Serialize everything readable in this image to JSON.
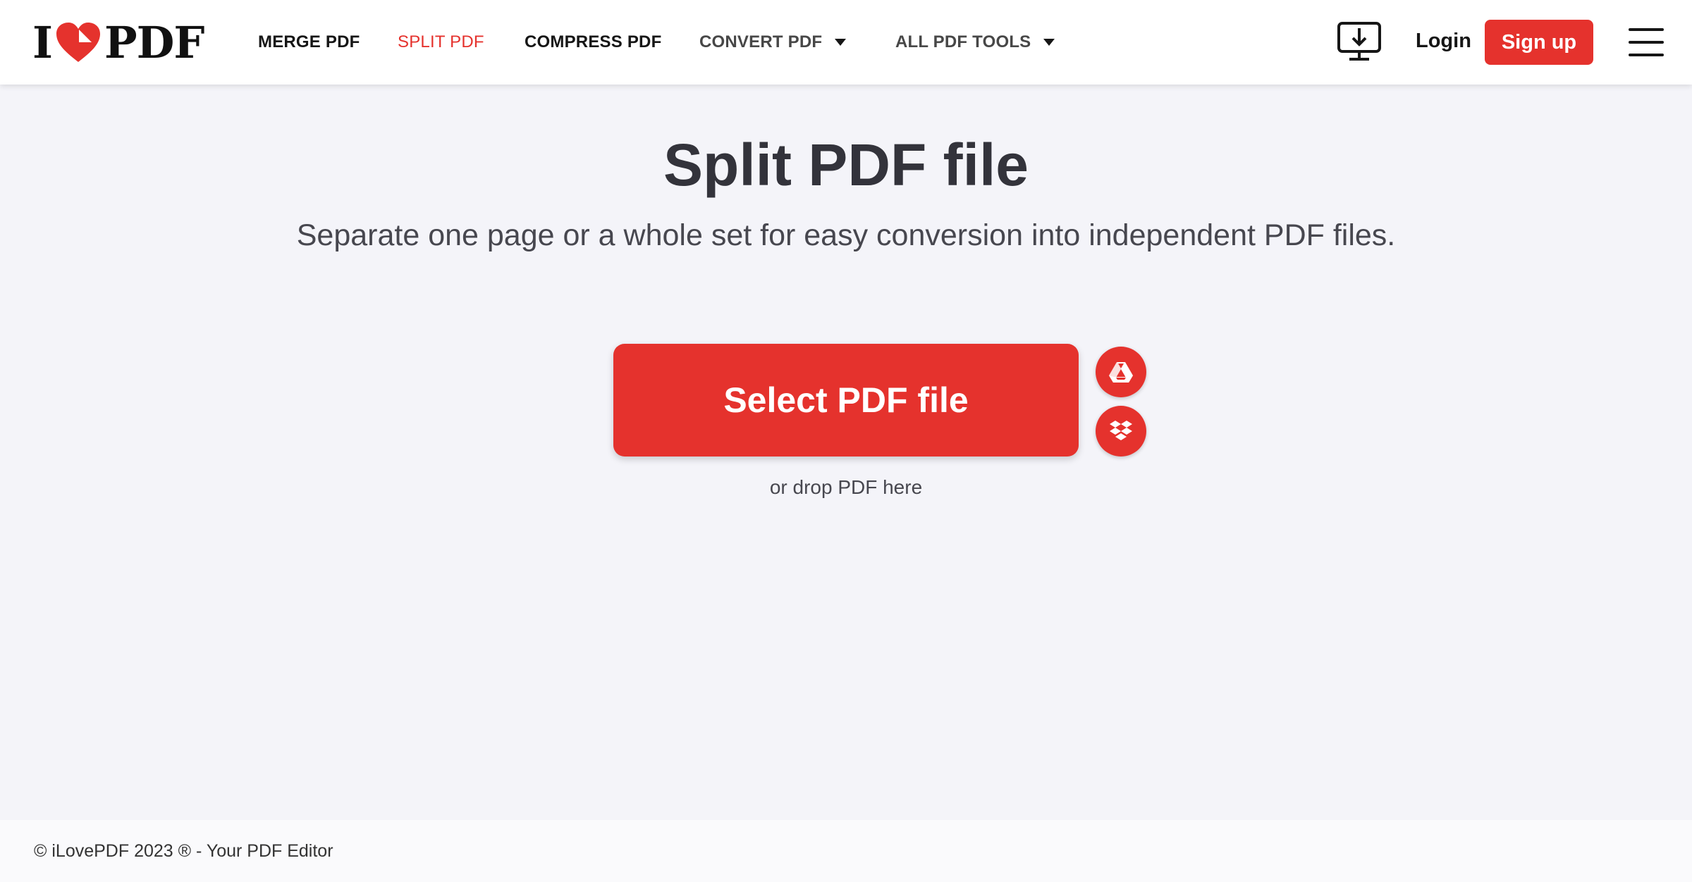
{
  "brand": {
    "logo_left": "I",
    "logo_right": "PDF",
    "accent_color": "#e5322d"
  },
  "nav": {
    "items": [
      {
        "label": "MERGE PDF"
      },
      {
        "label": "SPLIT PDF"
      },
      {
        "label": "COMPRESS PDF"
      },
      {
        "label": "CONVERT PDF"
      },
      {
        "label": "ALL PDF TOOLS"
      }
    ]
  },
  "header": {
    "desktop_icon": "desktop-download-icon",
    "login_label": "Login",
    "signup_label": "Sign up",
    "menu_icon": "hamburger-menu-icon"
  },
  "main": {
    "title": "Split PDF file",
    "subtitle": "Separate one page or a whole set for easy conversion into independent PDF files.",
    "select_label": "Select PDF file",
    "gdrive_icon": "google-drive-icon",
    "dropbox_icon": "dropbox-icon",
    "drop_hint": "or drop PDF here"
  },
  "footer": {
    "text": "© iLovePDF 2023 ® - Your PDF Editor"
  }
}
